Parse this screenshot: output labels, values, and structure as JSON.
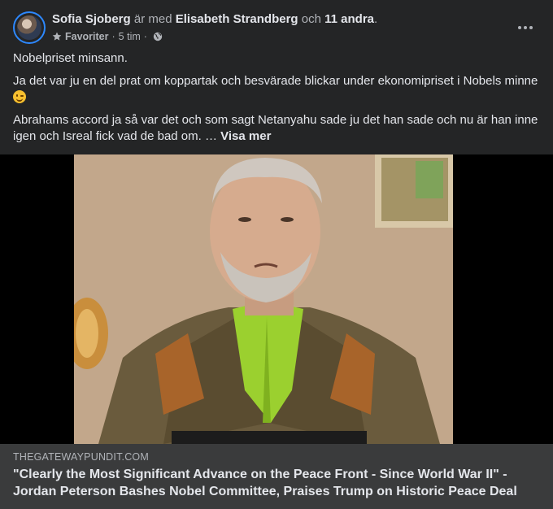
{
  "post": {
    "author": "Sofia Sjoberg",
    "with_text": "är med",
    "tagged_person": "Elisabeth Strandberg",
    "and_text": "och",
    "others": "11 andra",
    "end_punct": ".",
    "audience_label": "Favoriter",
    "time": "5 tim",
    "dot": "·",
    "icons": {
      "favorite": "star-icon",
      "privacy": "globe-icon",
      "more": "more-options-icon",
      "emoji": "winking-face-emoji"
    },
    "paragraphs": {
      "p1": "Nobelpriset minsann.",
      "p2": "Ja det var ju en del prat om koppartak och besvärade blickar under ekonomipriset i Nobels minne ",
      "p3": "Abrahams accord ja så var det och som sagt Netanyahu sade ju det han sade och nu är han inne igen och Isreal fick vad de bad om. … "
    },
    "see_more": "Visa mer"
  },
  "link_preview": {
    "domain": "THEGATEWAYPUNDIT.COM",
    "headline": "\"Clearly the Most Significant Advance on the Peace Front - Since World War II\" - Jordan Peterson Bashes Nobel Committee, Praises Trump on Historic Peace Deal"
  },
  "colors": {
    "card_bg": "#242526",
    "link_bg": "#3a3b3c",
    "primary_text": "#e4e6eb",
    "secondary_text": "#b0b3b8",
    "avatar_ring": "#2d88ff"
  }
}
